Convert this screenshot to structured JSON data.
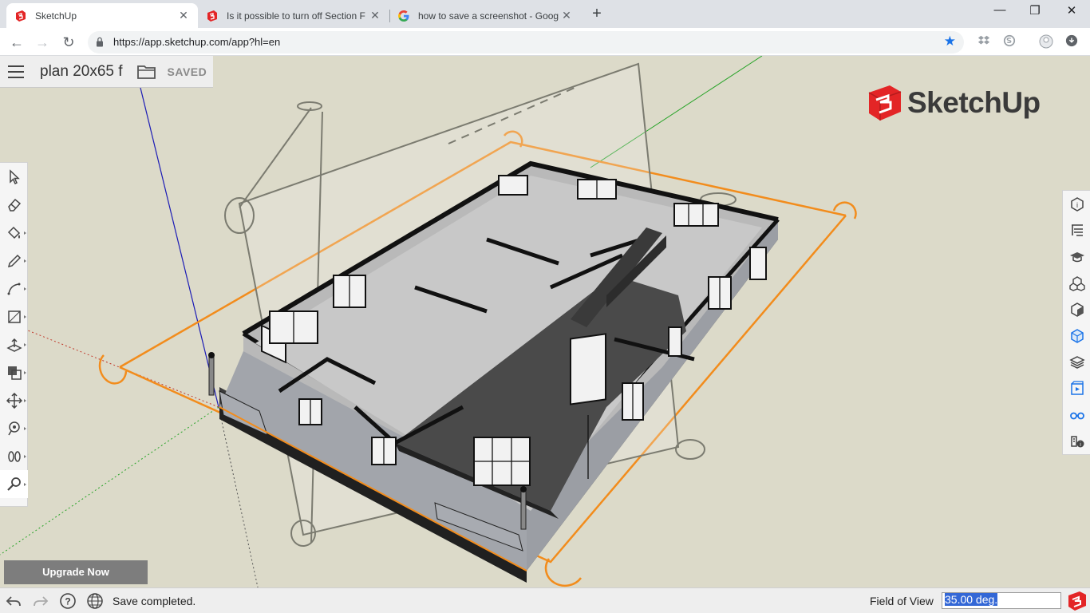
{
  "browser": {
    "tabs": [
      {
        "title": "SketchUp",
        "close": "✕",
        "active": true
      },
      {
        "title": "Is it possible to turn off Section F",
        "close": "✕",
        "active": false
      },
      {
        "title": "how to save a screenshot - Goog",
        "close": "✕",
        "active": false
      }
    ],
    "new_tab": "+",
    "window_controls": {
      "minimize": "—",
      "restore": "❐",
      "close": "✕"
    },
    "url": "https://app.sketchup.com/app?hl=en",
    "nav": {
      "back": "←",
      "forward": "→",
      "reload": "↻"
    },
    "bookmark_star": "★",
    "star_color": "#1a73e8"
  },
  "app": {
    "hamburger_icon": "menu-icon",
    "doc_title": "plan 20x65 f",
    "folder_icon": "folder-icon",
    "saved_label": "SAVED",
    "brand_name": "SketchUp",
    "brand_color": "#e32526",
    "left_tools": [
      {
        "name": "select-tool-icon",
        "more": false
      },
      {
        "name": "eraser-tool-icon",
        "more": false
      },
      {
        "name": "paint-bucket-tool-icon",
        "more": true
      },
      {
        "name": "pencil-tool-icon",
        "more": true
      },
      {
        "name": "arc-tool-icon",
        "more": true
      },
      {
        "name": "rectangle-tool-icon",
        "more": true
      },
      {
        "name": "push-pull-tool-icon",
        "more": true
      },
      {
        "name": "offset-tool-icon",
        "more": true
      },
      {
        "name": "move-tool-icon",
        "more": true
      },
      {
        "name": "tape-measure-tool-icon",
        "more": true
      },
      {
        "name": "walk-tool-icon",
        "more": true
      },
      {
        "name": "zoom-tool-icon",
        "more": true,
        "active": true
      }
    ],
    "right_tools": [
      "entity-info-icon",
      "outliner-icon",
      "instructor-icon",
      "components-icon",
      "materials-icon",
      "styles-icon",
      "layers-icon",
      "scenes-icon",
      "display-icon",
      "model-info-icon"
    ],
    "upgrade_label": "Upgrade Now",
    "status": {
      "message": "Save completed.",
      "fov_label": "Field of View",
      "fov_value": "35.00 deg.",
      "icons": [
        "undo-icon",
        "redo-icon",
        "help-icon",
        "globe-icon"
      ],
      "help_glyph": "?"
    }
  }
}
